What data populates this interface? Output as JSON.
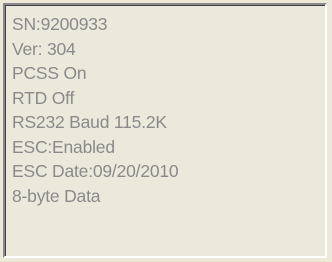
{
  "listbox": {
    "items": [
      {
        "text": "SN:9200933"
      },
      {
        "text": "Ver: 304"
      },
      {
        "text": "PCSS On"
      },
      {
        "text": "RTD Off"
      },
      {
        "text": "RS232 Baud 115.2K"
      },
      {
        "text": "ESC:Enabled"
      },
      {
        "text": "ESC Date:09/20/2010"
      },
      {
        "text": "8-byte Data"
      }
    ]
  },
  "colors": {
    "window_background": "#ece9d8",
    "list_background": "#ebe9dc",
    "disabled_text": "#8a8a8a"
  }
}
